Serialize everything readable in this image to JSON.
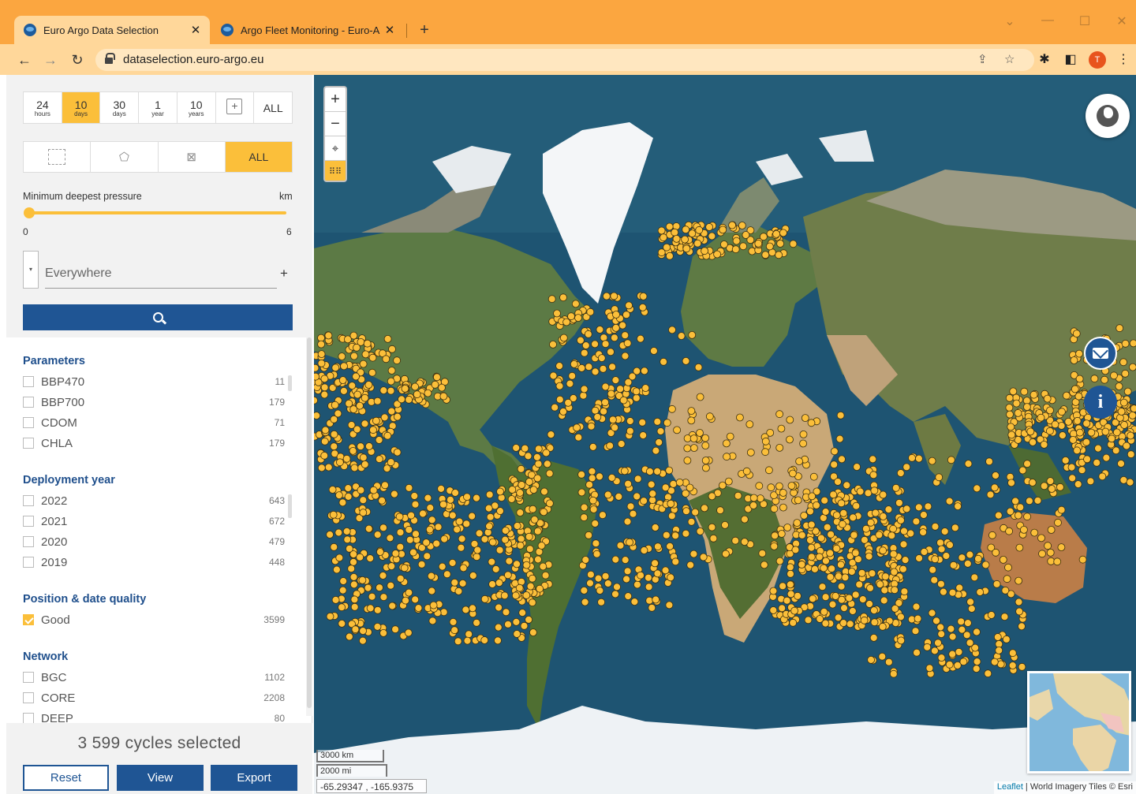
{
  "browser": {
    "tabs": [
      {
        "title": "Euro Argo Data Selection",
        "active": true
      },
      {
        "title": "Argo Fleet Monitoring - Euro-Argo",
        "active": false
      }
    ],
    "url": "dataselection.euro-argo.eu",
    "profile_initial": "T",
    "accent_color": "#fba640"
  },
  "time_filter": {
    "options": [
      {
        "num": "24",
        "unit": "hours",
        "selected": false
      },
      {
        "num": "10",
        "unit": "days",
        "selected": true
      },
      {
        "num": "30",
        "unit": "days",
        "selected": false
      },
      {
        "num": "1",
        "unit": "year",
        "selected": false
      },
      {
        "num": "10",
        "unit": "years",
        "selected": false
      }
    ],
    "all_label": "ALL"
  },
  "shape_filter": {
    "all_label": "ALL",
    "selected": "ALL"
  },
  "pressure": {
    "label": "Minimum deepest pressure",
    "unit": "km",
    "min": "0",
    "max": "6",
    "value": 0
  },
  "location": {
    "placeholder": "Everywhere"
  },
  "facets": {
    "parameters": {
      "title": "Parameters",
      "items": [
        {
          "label": "BBP470",
          "count": "11"
        },
        {
          "label": "BBP700",
          "count": "179"
        },
        {
          "label": "CDOM",
          "count": "71"
        },
        {
          "label": "CHLA",
          "count": "179"
        }
      ]
    },
    "deployment_year": {
      "title": "Deployment year",
      "items": [
        {
          "label": "2022",
          "count": "643"
        },
        {
          "label": "2021",
          "count": "672"
        },
        {
          "label": "2020",
          "count": "479"
        },
        {
          "label": "2019",
          "count": "448"
        }
      ]
    },
    "quality": {
      "title": "Position & date quality",
      "items": [
        {
          "label": "Good",
          "count": "3599",
          "checked": true
        }
      ]
    },
    "network": {
      "title": "Network",
      "items": [
        {
          "label": "BGC",
          "count": "1102"
        },
        {
          "label": "CORE",
          "count": "2208"
        },
        {
          "label": "DEEP",
          "count": "80"
        }
      ]
    }
  },
  "footer": {
    "count_text": "3 599 cycles selected",
    "reset": "Reset",
    "view": "View",
    "export": "Export"
  },
  "map": {
    "scale_km": "3000 km",
    "scale_mi": "2000 mi",
    "coords": "-65.29347 , -165.9375",
    "attribution_link": "Leaflet",
    "attribution_text": " | World Imagery Tiles © Esri",
    "marker_color": "#fbbf3a",
    "primary_color": "#1f5594"
  }
}
